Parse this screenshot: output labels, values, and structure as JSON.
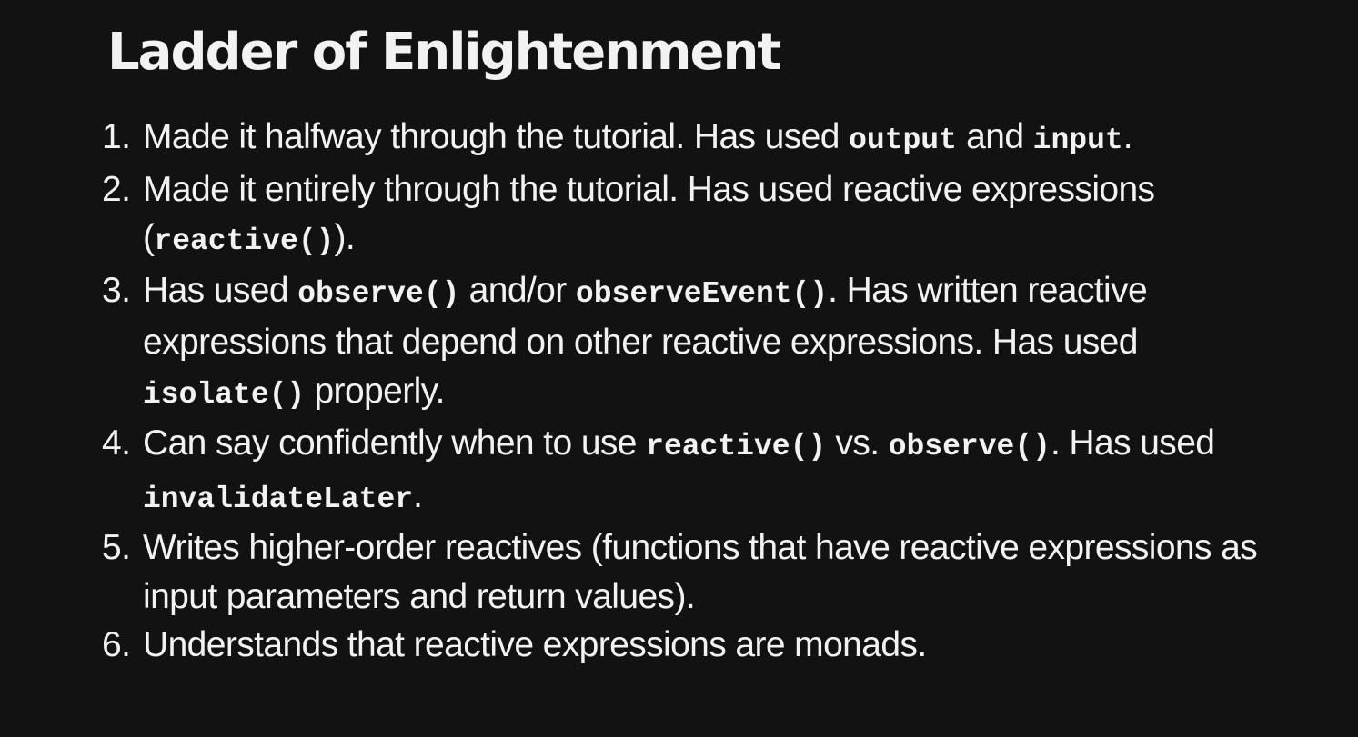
{
  "slide": {
    "title": "Ladder of Enlightenment",
    "items": [
      {
        "number": "1.",
        "parts": [
          {
            "text": "Made it halfway through the tutorial. Has used "
          },
          {
            "code": "output"
          },
          {
            "text": " and "
          },
          {
            "code": "input"
          },
          {
            "text": "."
          }
        ]
      },
      {
        "number": "2.",
        "parts": [
          {
            "text": "Made it entirely through the tutorial. Has used reactive expressions ("
          },
          {
            "code": "reactive()"
          },
          {
            "text": ")."
          }
        ]
      },
      {
        "number": "3.",
        "parts": [
          {
            "text": "Has used "
          },
          {
            "code": "observe()"
          },
          {
            "text": " and/or "
          },
          {
            "code": "observeEvent()"
          },
          {
            "text": ". Has written reactive expressions that depend on other reactive expressions. Has used "
          },
          {
            "code": "isolate()"
          },
          {
            "text": " properly."
          }
        ]
      },
      {
        "number": "4.",
        "parts": [
          {
            "text": "Can say confidently when to use "
          },
          {
            "code": "reactive()"
          },
          {
            "text": " vs. "
          },
          {
            "code": "observe()"
          },
          {
            "text": ". Has used "
          },
          {
            "code": "invalidateLater"
          },
          {
            "text": "."
          }
        ]
      },
      {
        "number": "5.",
        "parts": [
          {
            "text": "Writes higher-order reactives (functions that have reactive expressions as input parameters and return values)."
          }
        ]
      },
      {
        "number": "6.",
        "parts": [
          {
            "text": "Understands that reactive expressions are monads."
          }
        ]
      }
    ]
  }
}
